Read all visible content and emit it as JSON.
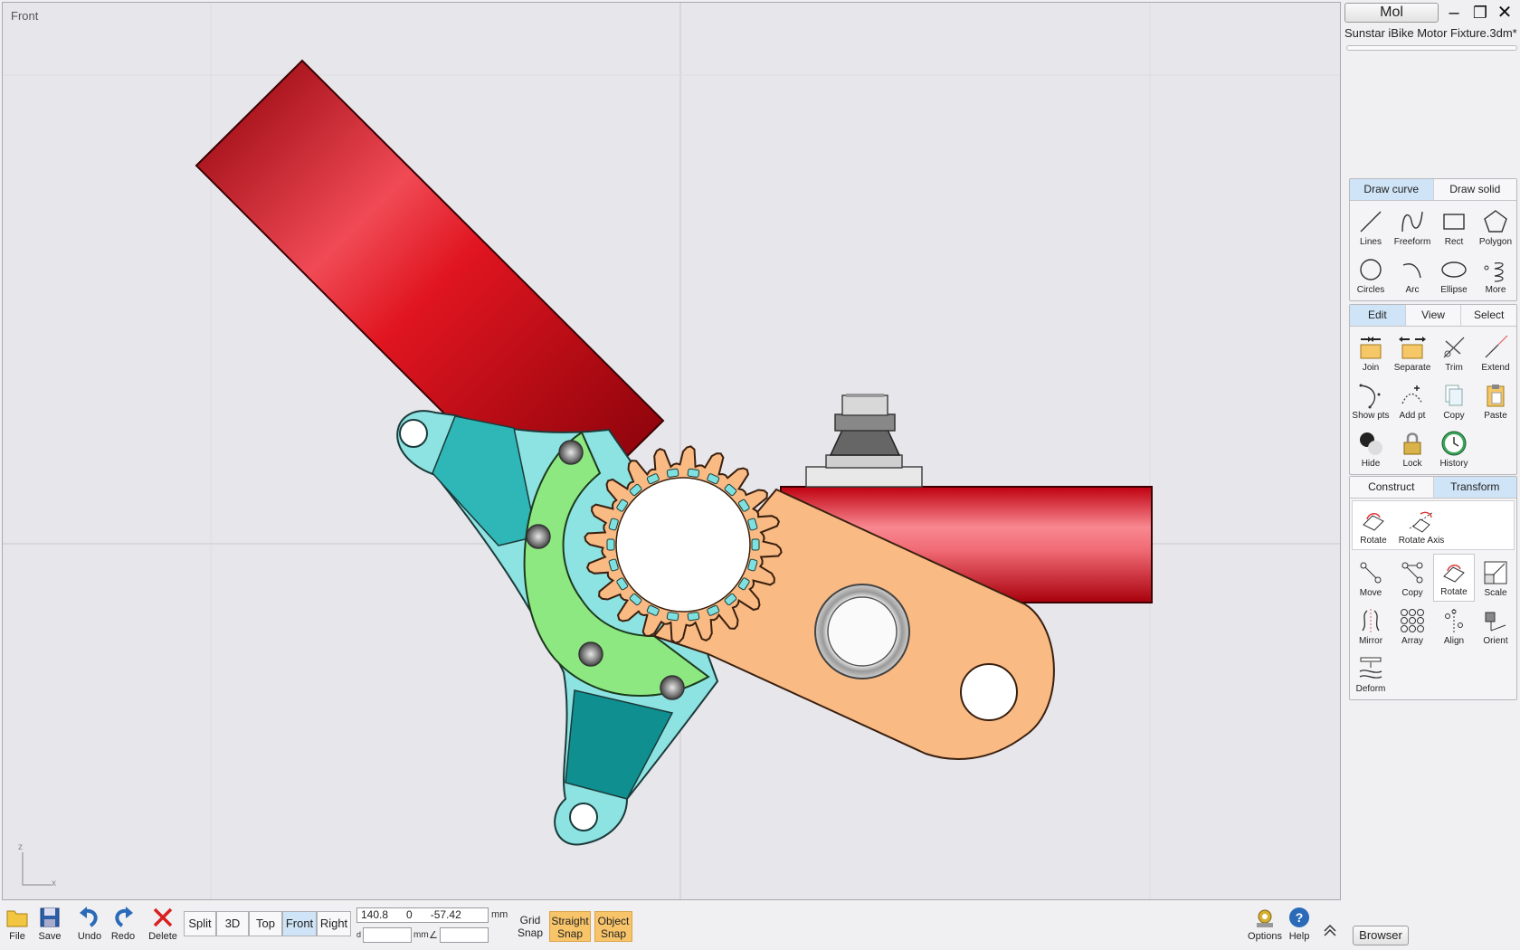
{
  "viewport": {
    "label": "Front",
    "axis_z": "z",
    "axis_x": "x"
  },
  "panel": {
    "mol_label": "Mol",
    "minimize": "–",
    "maximize": "❐",
    "close": "✕",
    "doc_title": "Sunstar iBike Motor Fixture.3dm*"
  },
  "draw": {
    "tabs": [
      "Draw curve",
      "Draw solid"
    ],
    "active_tab": "Draw curve",
    "tools": [
      "Lines",
      "Freeform",
      "Rect",
      "Polygon",
      "Circles",
      "Arc",
      "Ellipse",
      "More"
    ]
  },
  "edit": {
    "tabs": [
      "Edit",
      "View",
      "Select"
    ],
    "active_tab": "Edit",
    "tools": [
      "Join",
      "Separate",
      "Trim",
      "Extend",
      "Show pts",
      "Add pt",
      "Copy",
      "Paste",
      "Hide",
      "Lock",
      "History"
    ]
  },
  "transform": {
    "tabs": [
      "Construct",
      "Transform"
    ],
    "active_tab": "Transform",
    "sub_tools": [
      "Rotate",
      "Rotate Axis"
    ],
    "tools": [
      "Move",
      "Copy",
      "Rotate",
      "Scale",
      "Mirror",
      "Array",
      "Align",
      "Orient",
      "Deform"
    ]
  },
  "toolbar": {
    "file": "File",
    "save": "Save",
    "undo": "Undo",
    "redo": "Redo",
    "delete": "Delete",
    "views": [
      "Split",
      "3D",
      "Top",
      "Front",
      "Right"
    ],
    "active_view": "Front",
    "coords": "140.8      0      -57.42",
    "coord_unit": "mm",
    "distance_prefix": "d",
    "distance_unit": "mm",
    "angle_symbol": "∠",
    "grid_snap_1": "Grid",
    "grid_snap_2": "Snap",
    "straight_snap_1": "Straight",
    "straight_snap_2": "Snap",
    "object_snap_1": "Object",
    "object_snap_2": "Snap",
    "options": "Options",
    "help": "Help",
    "browser": "Browser"
  }
}
